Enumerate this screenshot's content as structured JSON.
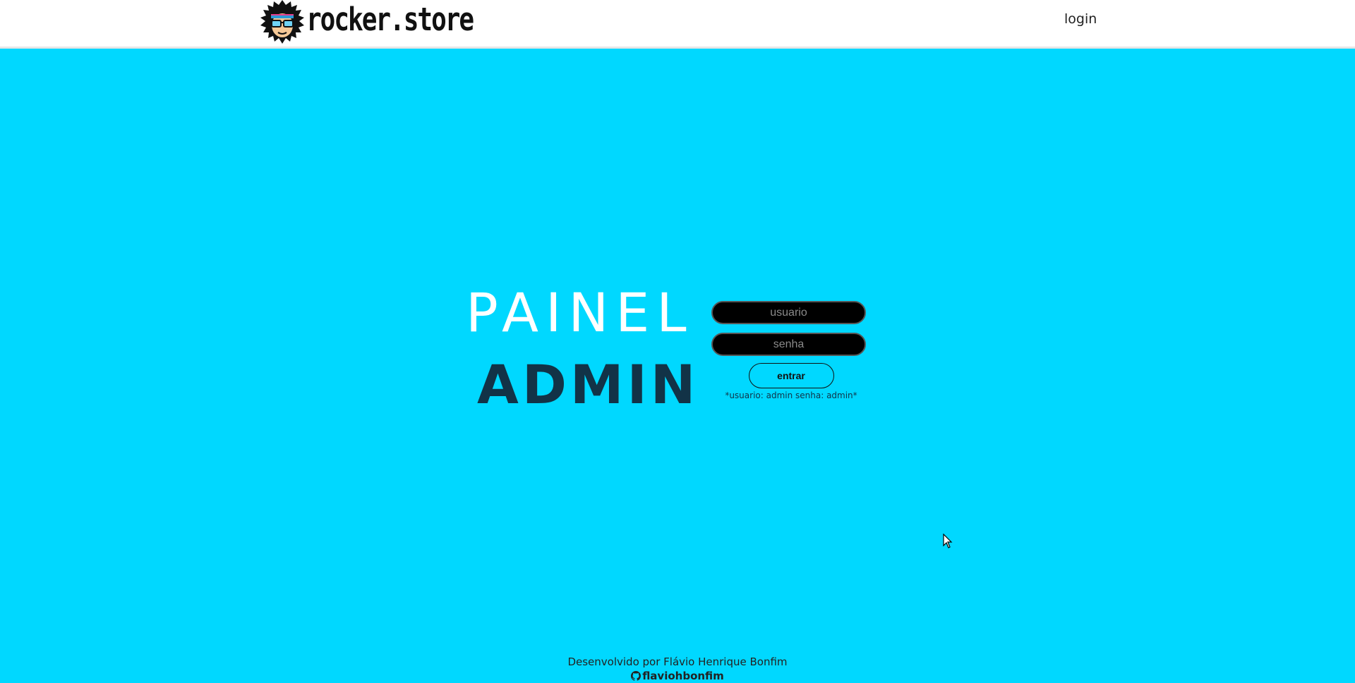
{
  "header": {
    "logo_text": "rocker.store",
    "logo_icon": "rocker-mascot-icon",
    "nav_login": "login"
  },
  "main": {
    "title_line1": "PAINEL",
    "title_line2": "ADMIN"
  },
  "form": {
    "user_placeholder": "usuario",
    "user_value": "",
    "password_placeholder": "senha",
    "password_value": "",
    "submit_label": "entrar",
    "hint": "*usuario: admin senha: admin*"
  },
  "footer": {
    "credit": "Desenvolvido por Flávio Henrique Bonfim",
    "github_handle": "flaviohbonfim",
    "github_icon": "github-icon"
  },
  "colors": {
    "background": "#00d8ff",
    "header_bg": "#ffffff",
    "title_white": "#ffffff",
    "title_dark": "#123347",
    "input_bg": "#000000"
  }
}
